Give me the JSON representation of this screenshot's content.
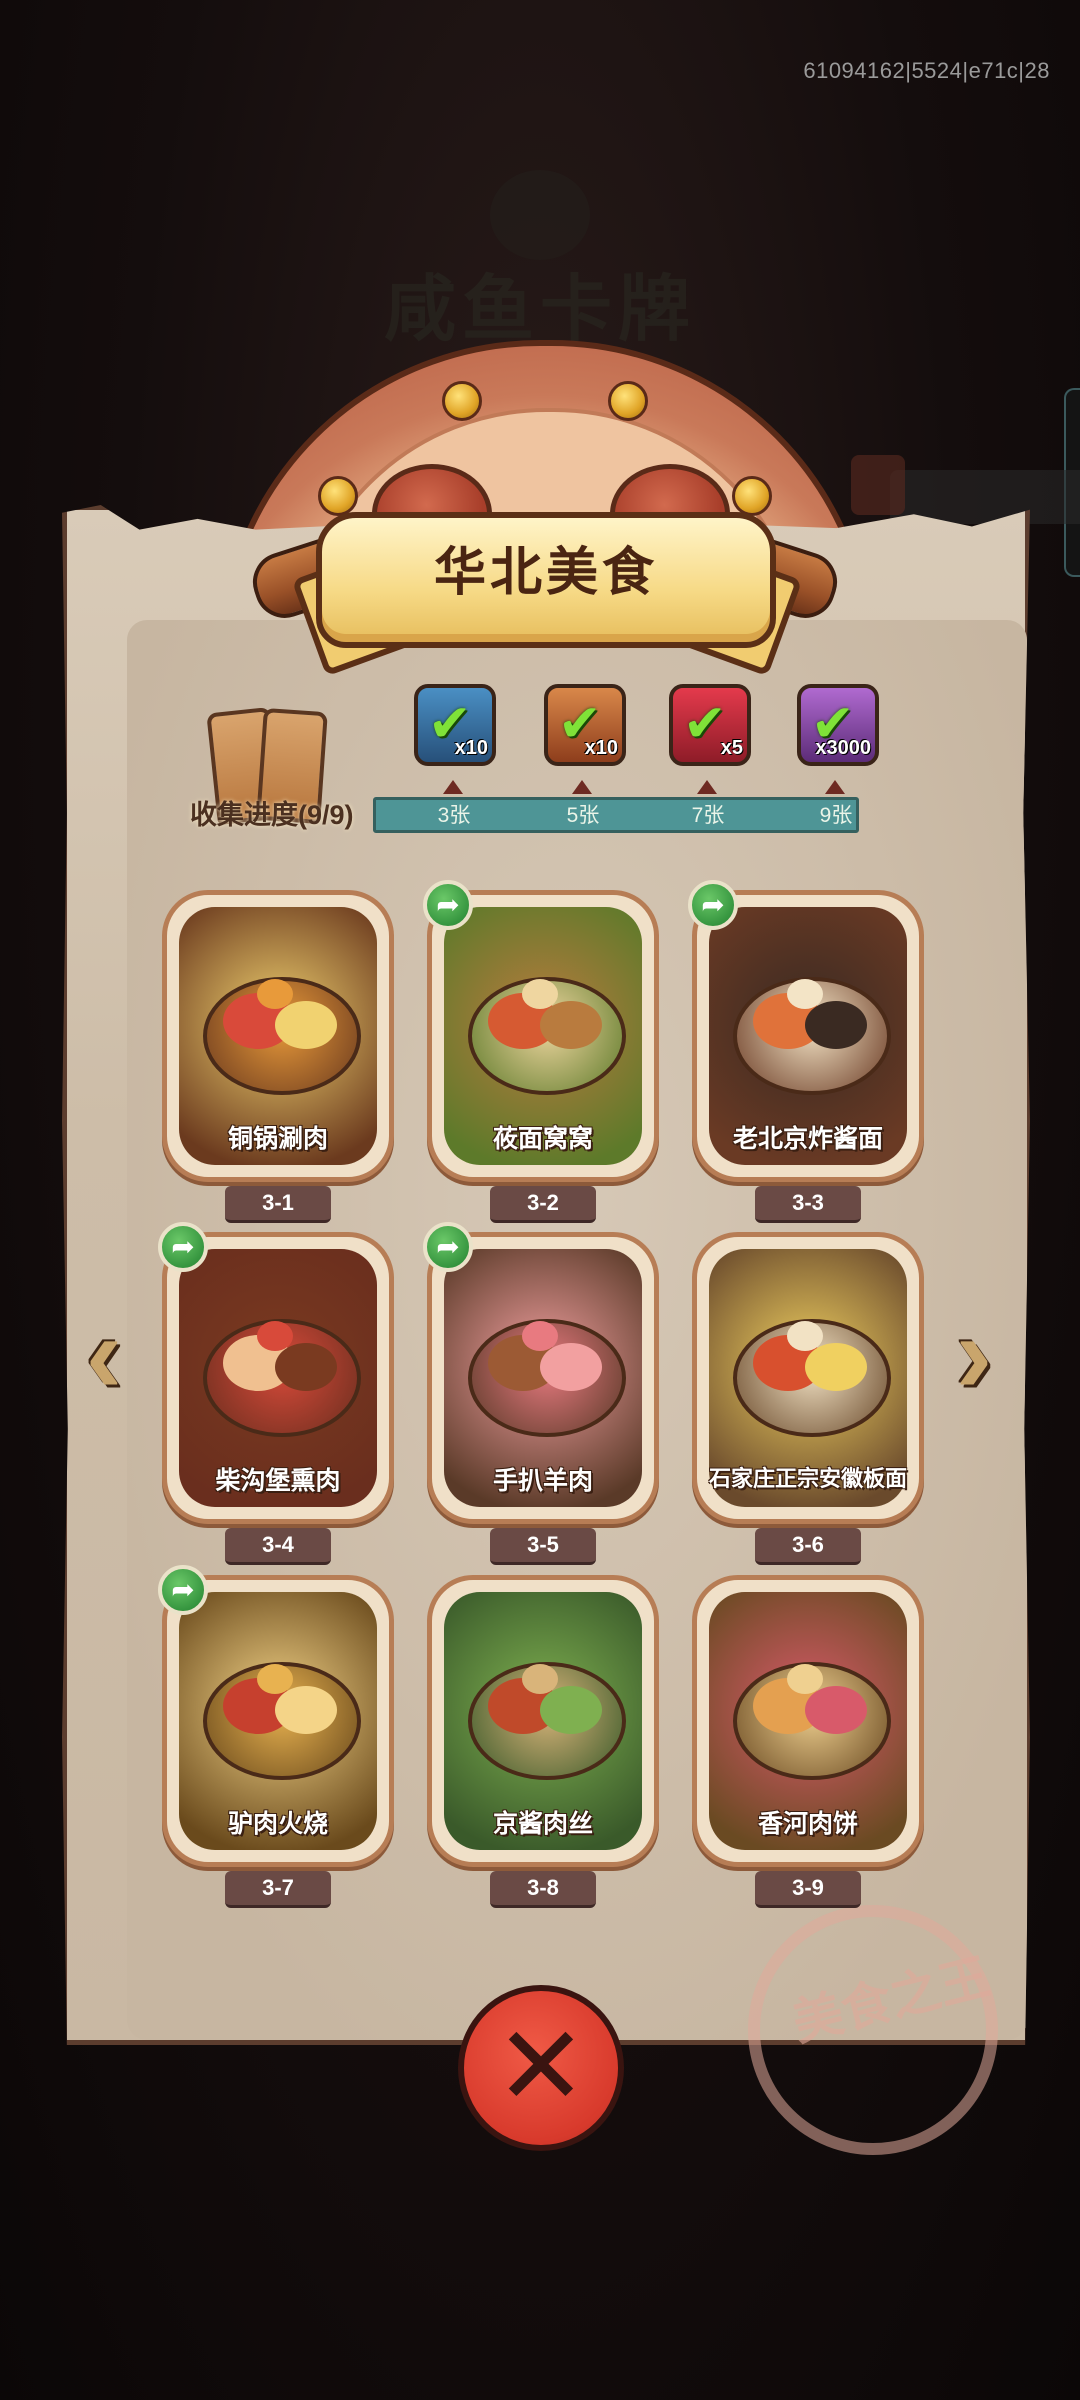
{
  "debug_id": "61094162|5524|e71c|28",
  "background_title": "咸鱼卡牌",
  "panel": {
    "title": "华北美食"
  },
  "collection": {
    "label": "收集进度(9/9)",
    "collected": 9,
    "total": 9,
    "progress_fraction": 1.0,
    "rewards": [
      {
        "icon": "treasure-chest-icon",
        "quantity": "x10",
        "claimed": true,
        "color": "#2e6a9a"
      },
      {
        "icon": "hammer-tool-icon",
        "quantity": "x10",
        "claimed": true,
        "color": "#b25a2c"
      },
      {
        "icon": "purple-orb-icon",
        "quantity": "x5",
        "claimed": true,
        "color": "#c22a3a"
      },
      {
        "icon": "silver-ingot-icon",
        "quantity": "x3000",
        "claimed": true,
        "color": "#8a4aa8"
      }
    ],
    "milestones": [
      "3张",
      "5张",
      "7张",
      "9张"
    ]
  },
  "cards": [
    {
      "name": "铜锅涮肉",
      "level": "3-1",
      "shareable": false
    },
    {
      "name": "莜面窝窝",
      "level": "3-2",
      "shareable": true
    },
    {
      "name": "老北京炸酱面",
      "level": "3-3",
      "shareable": true
    },
    {
      "name": "柴沟堡熏肉",
      "level": "3-4",
      "shareable": true
    },
    {
      "name": "手扒羊肉",
      "level": "3-5",
      "shareable": true
    },
    {
      "name": "石家庄正宗安徽板面",
      "level": "3-6",
      "shareable": false
    },
    {
      "name": "驴肉火烧",
      "level": "3-7",
      "shareable": true
    },
    {
      "name": "京酱肉丝",
      "level": "3-8",
      "shareable": false
    },
    {
      "name": "香河肉饼",
      "level": "3-9",
      "shareable": false
    }
  ],
  "stamp_text": "美食之王",
  "colors": {
    "accent_teal": "#4e9596",
    "close_red": "#d83a2c",
    "share_green": "#2f8f3a",
    "ribbon_gold": "#f6d985"
  }
}
